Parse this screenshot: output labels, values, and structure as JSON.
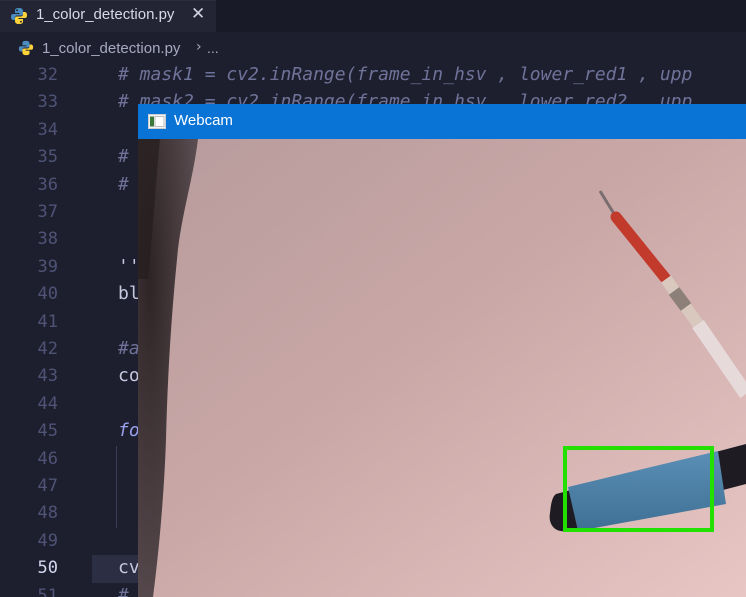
{
  "editor": {
    "tab": {
      "label": "1_color_detection.py",
      "close_glyph": "✕",
      "icon": "python-icon"
    },
    "breadcrumb": {
      "file": "1_color_detection.py",
      "separator": "›",
      "more": "..."
    },
    "lines": [
      {
        "number": "32",
        "text": "# mask1 = cv2.inRange(frame_in_hsv , lower_red1 , upp"
      },
      {
        "number": "33",
        "text": "# mask2 = cv2.inRange(frame_in_hsv , lower_red2 , upp"
      },
      {
        "number": "34",
        "text": ""
      },
      {
        "number": "35",
        "text": "#"
      },
      {
        "number": "36",
        "text": "#"
      },
      {
        "number": "37",
        "text": ""
      },
      {
        "number": "38",
        "text": ""
      },
      {
        "number": "39",
        "text": "''"
      },
      {
        "number": "40",
        "text": "bl"
      },
      {
        "number": "41",
        "text": ""
      },
      {
        "number": "42",
        "text": "#a"
      },
      {
        "number": "43",
        "text": "co"
      },
      {
        "number": "44",
        "text": ""
      },
      {
        "number": "45",
        "text": "fo"
      },
      {
        "number": "46",
        "text": ""
      },
      {
        "number": "47",
        "text": ""
      },
      {
        "number": "48",
        "text": ""
      },
      {
        "number": "49",
        "text": ""
      },
      {
        "number": "50",
        "text": "cv"
      },
      {
        "number": "51",
        "text": "#"
      }
    ],
    "current_line": "50"
  },
  "webcam": {
    "title": "Webcam",
    "detection_box_color": "#22e000"
  },
  "colors": {
    "editor_bg": "#1e1f2e",
    "titlebar_blue": "#0a74d6",
    "comment": "#6f7399"
  }
}
